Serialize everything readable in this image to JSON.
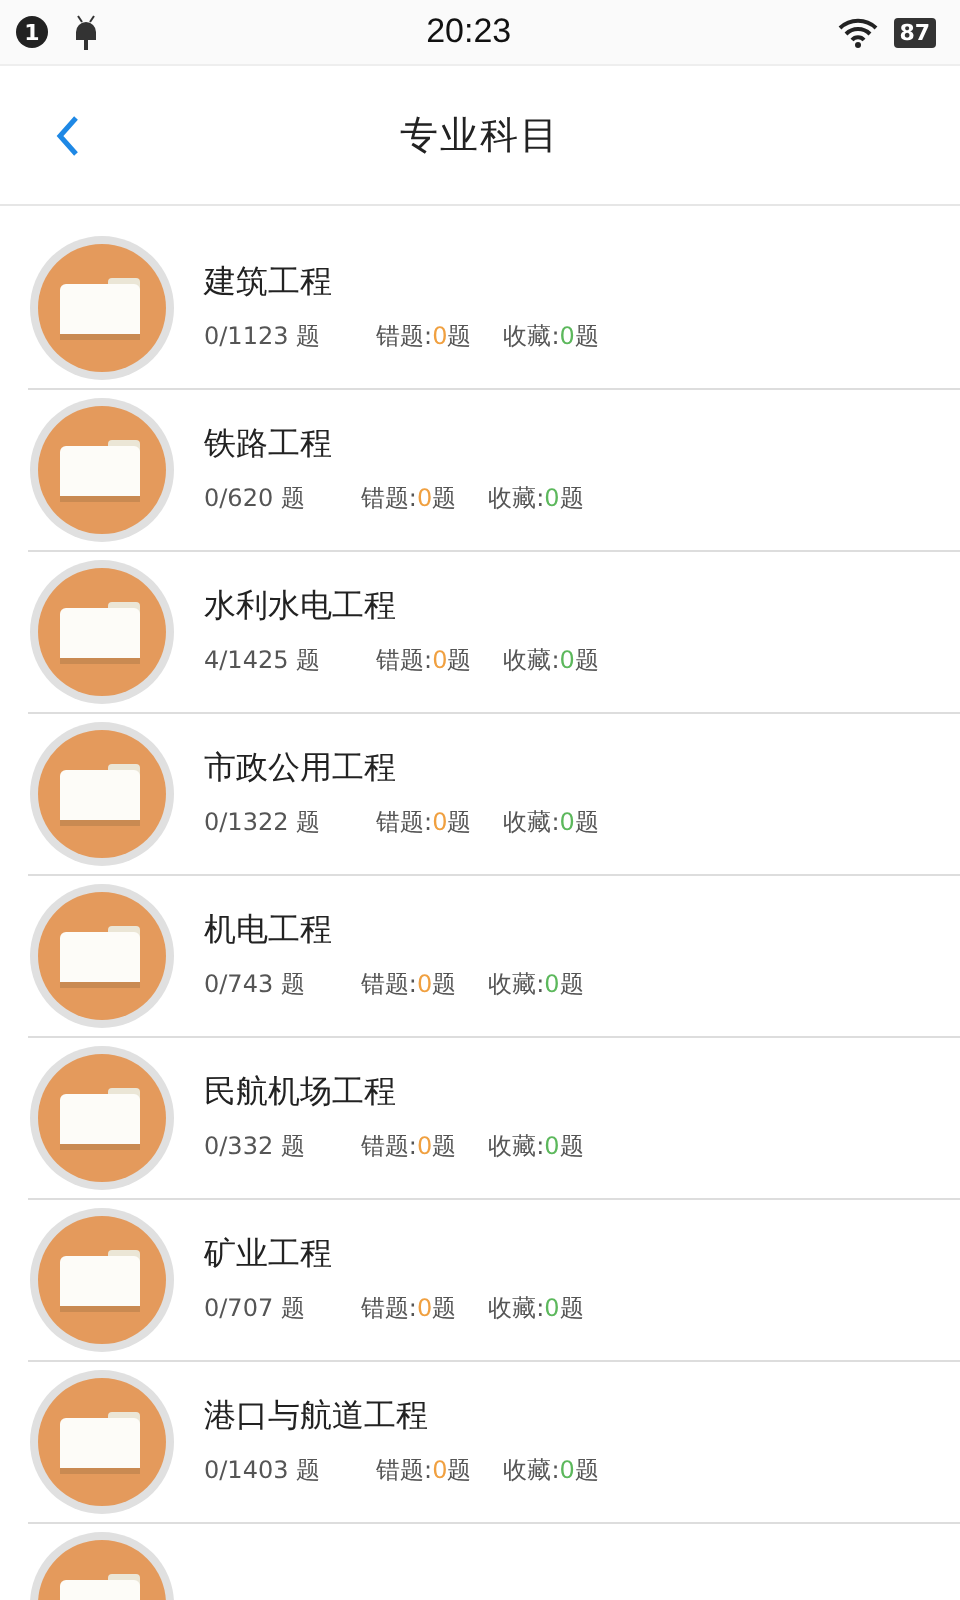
{
  "status_bar": {
    "notification_count": "1",
    "time": "20:23",
    "battery": "87"
  },
  "nav": {
    "title": "专业科目"
  },
  "subjects": [
    {
      "name": "建筑工程",
      "progress": "0/1123 题",
      "wrong": {
        "label": "错题:",
        "value": "0",
        "unit": "题"
      },
      "saved": {
        "label": "收藏:",
        "value": "0",
        "unit": "题"
      }
    },
    {
      "name": "铁路工程",
      "progress": "0/620 题",
      "wrong": {
        "label": "错题:",
        "value": "0",
        "unit": "题"
      },
      "saved": {
        "label": "收藏:",
        "value": "0",
        "unit": "题"
      }
    },
    {
      "name": "水利水电工程",
      "progress": "4/1425 题",
      "wrong": {
        "label": "错题:",
        "value": "0",
        "unit": "题"
      },
      "saved": {
        "label": "收藏:",
        "value": "0",
        "unit": "题"
      }
    },
    {
      "name": "市政公用工程",
      "progress": "0/1322 题",
      "wrong": {
        "label": "错题:",
        "value": "0",
        "unit": "题"
      },
      "saved": {
        "label": "收藏:",
        "value": "0",
        "unit": "题"
      }
    },
    {
      "name": "机电工程",
      "progress": "0/743 题",
      "wrong": {
        "label": "错题:",
        "value": "0",
        "unit": "题"
      },
      "saved": {
        "label": "收藏:",
        "value": "0",
        "unit": "题"
      }
    },
    {
      "name": "民航机场工程",
      "progress": "0/332 题",
      "wrong": {
        "label": "错题:",
        "value": "0",
        "unit": "题"
      },
      "saved": {
        "label": "收藏:",
        "value": "0",
        "unit": "题"
      }
    },
    {
      "name": "矿业工程",
      "progress": "0/707 题",
      "wrong": {
        "label": "错题:",
        "value": "0",
        "unit": "题"
      },
      "saved": {
        "label": "收藏:",
        "value": "0",
        "unit": "题"
      }
    },
    {
      "name": "港口与航道工程",
      "progress": "0/1403 题",
      "wrong": {
        "label": "错题:",
        "value": "0",
        "unit": "题"
      },
      "saved": {
        "label": "收藏:",
        "value": "0",
        "unit": "题"
      }
    }
  ],
  "more_below": true
}
